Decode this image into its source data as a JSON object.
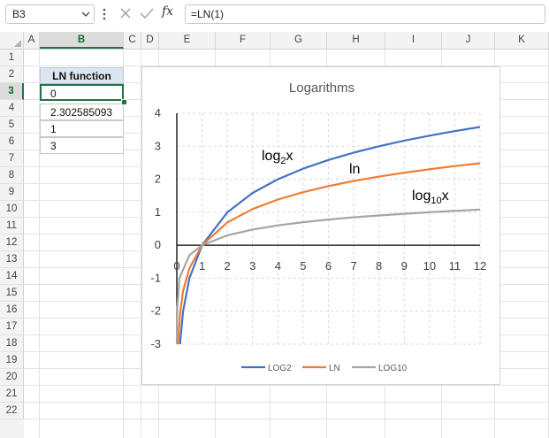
{
  "formula_bar": {
    "name_box": "B3",
    "formula": "=LN(1)",
    "fx_label": "fx"
  },
  "columns": [
    "A",
    "B",
    "C",
    "D",
    "E",
    "F",
    "G",
    "H",
    "I",
    "J",
    "K"
  ],
  "selected_column": "B",
  "rows": [
    "1",
    "2",
    "3",
    "4",
    "5",
    "6",
    "7",
    "8",
    "9",
    "10",
    "11",
    "12",
    "13",
    "14",
    "15",
    "16",
    "17",
    "18",
    "19",
    "20",
    "21",
    "22"
  ],
  "selected_row": "3",
  "table": {
    "header": "LN function",
    "values": [
      "0",
      "2.302585093",
      "1",
      "3"
    ]
  },
  "chart_data": {
    "type": "line",
    "title": "Logarithms",
    "xlim": [
      0,
      12
    ],
    "ylim": [
      -3,
      4
    ],
    "x_ticks": [
      "0",
      "1",
      "2",
      "3",
      "4",
      "5",
      "6",
      "7",
      "8",
      "9",
      "10",
      "11",
      "12"
    ],
    "y_ticks": [
      "-3",
      "-2",
      "-1",
      "0",
      "1",
      "2",
      "3",
      "4"
    ],
    "grid": true,
    "legend_position": "bottom",
    "series": [
      {
        "name": "LOG2",
        "color": "#4472c4",
        "x": [
          0.125,
          0.25,
          0.5,
          1,
          2,
          3,
          4,
          5,
          6,
          7,
          8,
          9,
          10,
          11,
          12
        ],
        "y": [
          -3,
          -2,
          -1,
          0,
          1,
          1.585,
          2,
          2.322,
          2.585,
          2.807,
          3,
          3.17,
          3.322,
          3.459,
          3.585
        ]
      },
      {
        "name": "LN",
        "color": "#ed7d31",
        "x": [
          0.05,
          0.125,
          0.25,
          0.5,
          1,
          2,
          3,
          4,
          5,
          6,
          7,
          8,
          9,
          10,
          11,
          12
        ],
        "y": [
          -2.996,
          -2.079,
          -1.386,
          -0.693,
          0,
          0.693,
          1.099,
          1.386,
          1.609,
          1.792,
          1.946,
          2.079,
          2.197,
          2.303,
          2.398,
          2.485
        ]
      },
      {
        "name": "LOG10",
        "color": "#a5a5a5",
        "x": [
          0.001,
          0.01,
          0.1,
          0.5,
          1,
          2,
          3,
          4,
          5,
          6,
          7,
          8,
          9,
          10,
          11,
          12
        ],
        "y": [
          -3,
          -2,
          -1,
          -0.301,
          0,
          0.301,
          0.477,
          0.602,
          0.699,
          0.778,
          0.845,
          0.903,
          0.954,
          1,
          1.041,
          1.079
        ]
      }
    ],
    "annotations": {
      "log2_base": "log",
      "log2_sub": "2",
      "log2_var": "x",
      "ln": "ln",
      "log10_base": "log",
      "log10_sub": "10",
      "log10_var": "x"
    }
  }
}
